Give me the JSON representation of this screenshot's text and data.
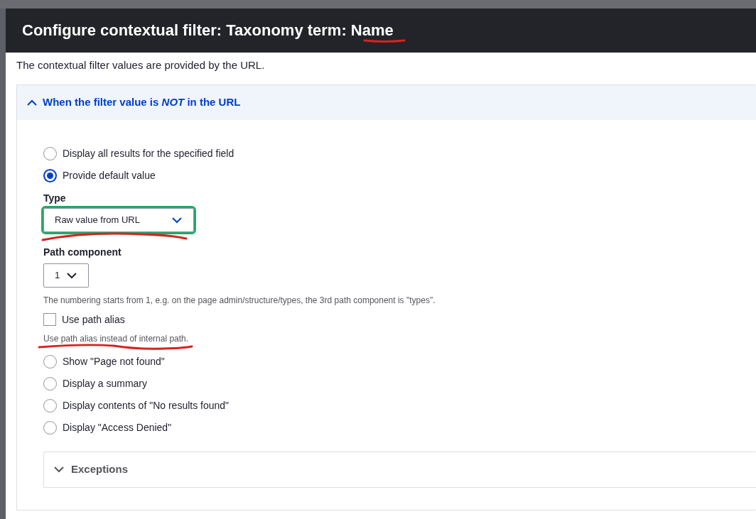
{
  "dialog": {
    "title": "Configure contextual filter: Taxonomy term: Name",
    "description": "The contextual filter values are provided by the URL.",
    "when_not_in_url": {
      "summary": "When the filter value is *NOT* in the URL",
      "expanded": true,
      "options": [
        {
          "label": "Display all results for the specified field",
          "selected": false
        },
        {
          "label": "Provide default value",
          "selected": true,
          "settings": {
            "type_field": {
              "label": "Type",
              "value": "Raw value from URL",
              "focused": true
            },
            "path_component": {
              "label": "Path component",
              "value": "1",
              "description": "The numbering starts from 1, e.g. on the page admin/structure/types, the 3rd path component is \"types\"."
            },
            "use_path_alias": {
              "label": "Use path alias",
              "checked": false,
              "description": "Use path alias instead of internal path."
            }
          }
        },
        {
          "label": "Show \"Page not found\"",
          "selected": false
        },
        {
          "label": "Display a summary",
          "selected": false
        },
        {
          "label": "Display contents of \"No results found\"",
          "selected": false
        },
        {
          "label": "Display \"Access Denied\"",
          "selected": false
        }
      ]
    },
    "exceptions": {
      "summary": "Exceptions",
      "expanded": false
    }
  }
}
